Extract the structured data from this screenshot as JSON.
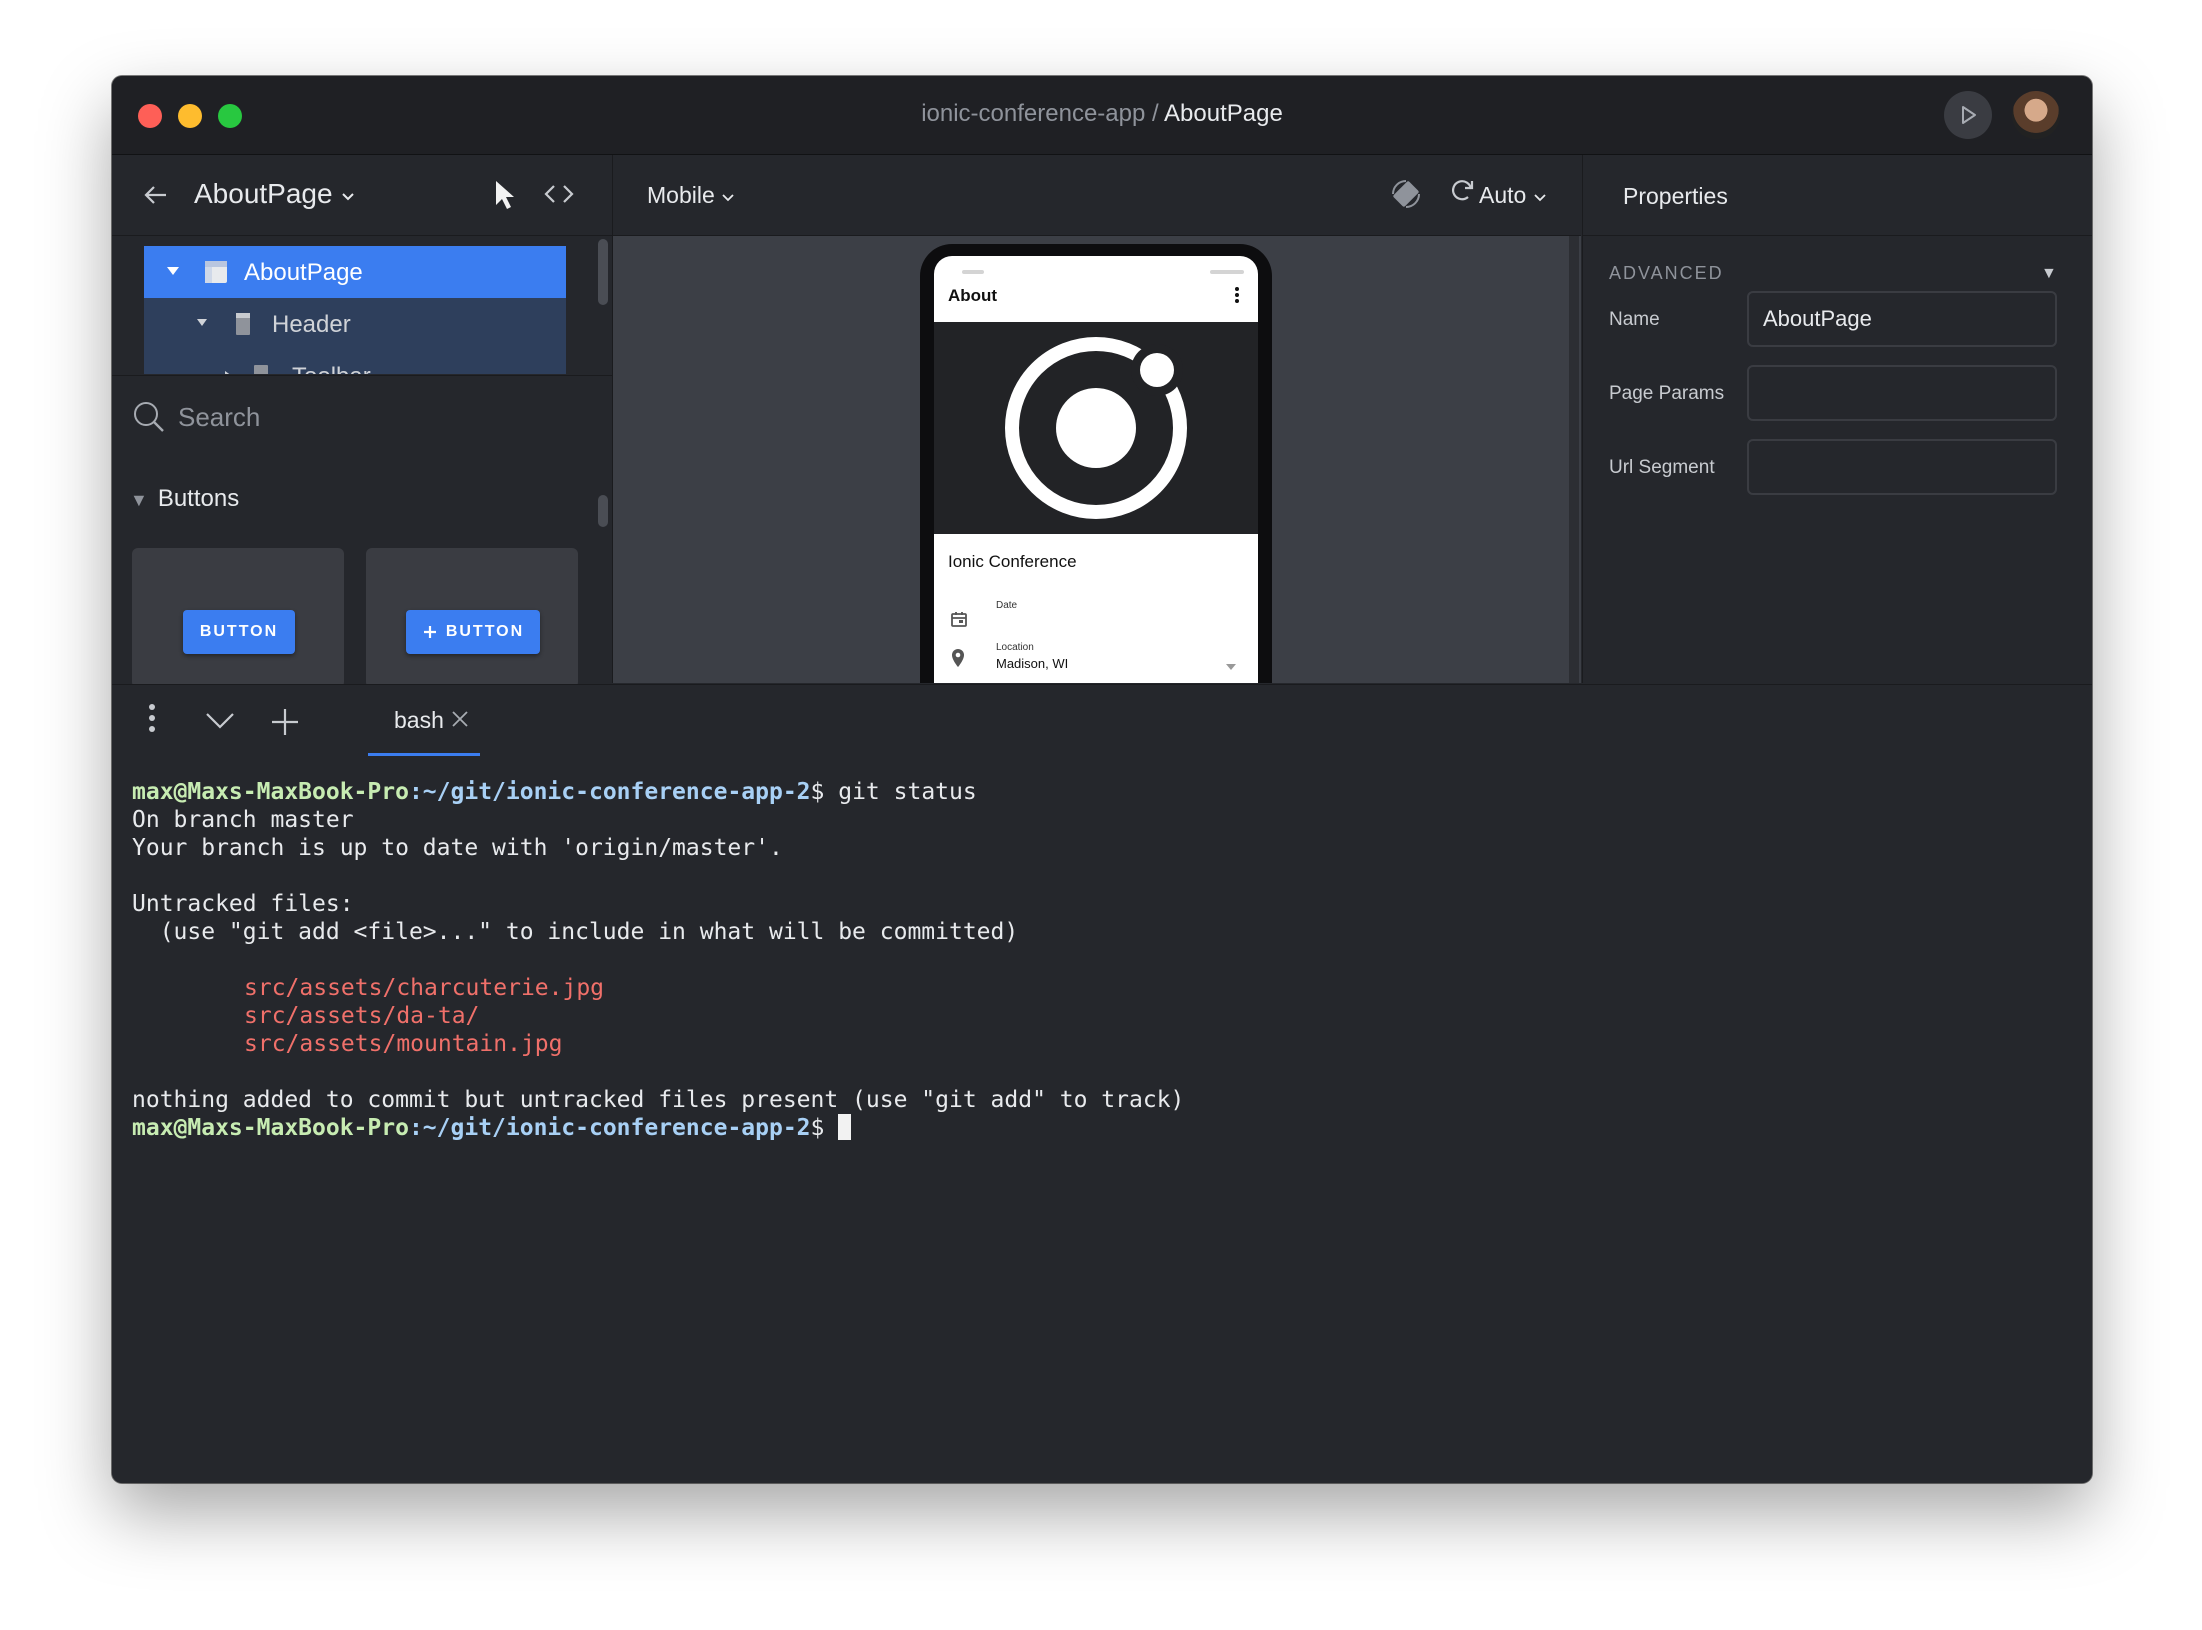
{
  "window": {
    "title_project": "ionic-conference-app",
    "title_separator": " / ",
    "title_page": "AboutPage",
    "controls": [
      "close",
      "minimize",
      "maximize"
    ]
  },
  "left_panel": {
    "page_selector": "AboutPage",
    "tree": [
      {
        "label": "AboutPage",
        "selected": true
      },
      {
        "label": "Header",
        "selected": false
      },
      {
        "label": "Toolbar",
        "selected": false
      }
    ],
    "search": {
      "placeholder": "Search"
    },
    "section": {
      "label": "Buttons"
    },
    "components": [
      {
        "label": "BUTTON"
      },
      {
        "label": "BUTTON",
        "icon": "plus-icon"
      }
    ]
  },
  "canvas_toolbar": {
    "device": "Mobile",
    "zoom": "Auto"
  },
  "preview": {
    "page_title": "About",
    "conference_name": "Ionic Conference",
    "date_label": "Date",
    "location_label": "Location",
    "location_value": "Madison, WI"
  },
  "properties": {
    "title": "Properties",
    "section": "ADVANCED",
    "fields": [
      {
        "label": "Name",
        "value": "AboutPage"
      },
      {
        "label": "Page Params",
        "value": ""
      },
      {
        "label": "Url Segment",
        "value": ""
      }
    ]
  },
  "terminal": {
    "tabs": [
      {
        "label": "bash",
        "active": true
      }
    ],
    "prompt_user": "max@Maxs-MaxBook-Pro",
    "prompt_path": ":~/git/ionic-conference-app-2",
    "prompt_symbol": "$",
    "command": " git status",
    "output": {
      "branch": "On branch master",
      "uptodate": "Your branch is up to date with 'origin/master'.",
      "untracked_header": "Untracked files:",
      "hint": "  (use \"git add <file>...\" to include in what will be committed)",
      "files": [
        "src/assets/charcuterie.jpg",
        "src/assets/da-ta/",
        "src/assets/mountain.jpg"
      ],
      "summary": "nothing added to commit but untracked files present (use \"git add\" to track)"
    }
  },
  "colors": {
    "accent": "#3b7df0",
    "background": "#25272c",
    "untracked": "#f0706a",
    "prompt_user": "#c7ecb2",
    "prompt_path": "#a8d0f5"
  }
}
